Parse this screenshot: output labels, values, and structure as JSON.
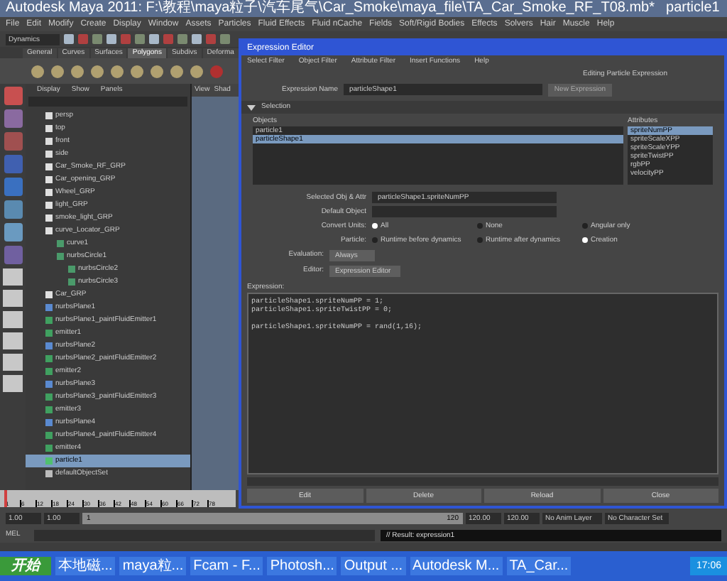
{
  "main_window": {
    "title": "Autodesk Maya 2011: F:\\教程\\maya粒子\\汽车尾气\\Car_Smoke\\maya_file\\TA_Car_Smoke_RF_T08.mb*",
    "subtitle": "particle1"
  },
  "menu_bar": [
    "File",
    "Edit",
    "Modify",
    "Create",
    "Display",
    "Window",
    "Assets",
    "Particles",
    "Fluid Effects",
    "Fluid nCache",
    "Fields",
    "Soft/Rigid Bodies",
    "Effects",
    "Solvers",
    "Hair",
    "Muscle",
    "Help"
  ],
  "mode_menu": "Dynamics",
  "shelf_tabs": [
    {
      "label": "General",
      "selected": false
    },
    {
      "label": "Curves",
      "selected": false
    },
    {
      "label": "Surfaces",
      "selected": false
    },
    {
      "label": "Polygons",
      "selected": true
    },
    {
      "label": "Subdivs",
      "selected": false
    },
    {
      "label": "Deforma",
      "selected": false
    }
  ],
  "outliner": {
    "menus": [
      "Display",
      "Show",
      "Panels"
    ],
    "items": [
      {
        "label": "persp",
        "kind": "camera",
        "selected": false
      },
      {
        "label": "top",
        "kind": "camera",
        "selected": false
      },
      {
        "label": "front",
        "kind": "camera",
        "selected": false
      },
      {
        "label": "side",
        "kind": "camera",
        "selected": false
      },
      {
        "label": "Car_Smoke_RF_GRP",
        "kind": "group",
        "selected": false
      },
      {
        "label": "Car_opening_GRP",
        "kind": "group",
        "selected": false
      },
      {
        "label": "Wheel_GRP",
        "kind": "group",
        "selected": false
      },
      {
        "label": "light_GRP",
        "kind": "group",
        "selected": false
      },
      {
        "label": "smoke_light_GRP",
        "kind": "group",
        "selected": false
      },
      {
        "label": "curve_Locator_GRP",
        "kind": "group",
        "selected": false,
        "children": [
          {
            "label": "curve1",
            "kind": "curve",
            "selected": false
          },
          {
            "label": "nurbsCircle1",
            "kind": "curve",
            "selected": false,
            "children": [
              {
                "label": "nurbsCircle2",
                "kind": "curve",
                "selected": false
              },
              {
                "label": "nurbsCircle3",
                "kind": "curve",
                "selected": false
              }
            ]
          }
        ]
      },
      {
        "label": "Car_GRP",
        "kind": "group",
        "selected": false
      },
      {
        "label": "nurbsPlane1",
        "kind": "plane",
        "selected": false
      },
      {
        "label": "nurbsPlane1_paintFluidEmitter1",
        "kind": "emitter",
        "selected": false
      },
      {
        "label": "emitter1",
        "kind": "emitter",
        "selected": false
      },
      {
        "label": "nurbsPlane2",
        "kind": "plane",
        "selected": false
      },
      {
        "label": "nurbsPlane2_paintFluidEmitter2",
        "kind": "emitter",
        "selected": false
      },
      {
        "label": "emitter2",
        "kind": "emitter",
        "selected": false
      },
      {
        "label": "nurbsPlane3",
        "kind": "plane",
        "selected": false
      },
      {
        "label": "nurbsPlane3_paintFluidEmitter3",
        "kind": "emitter",
        "selected": false
      },
      {
        "label": "emitter3",
        "kind": "emitter",
        "selected": false
      },
      {
        "label": "nurbsPlane4",
        "kind": "plane",
        "selected": false
      },
      {
        "label": "nurbsPlane4_paintFluidEmitter4",
        "kind": "emitter",
        "selected": false
      },
      {
        "label": "emitter4",
        "kind": "emitter",
        "selected": false
      },
      {
        "label": "particle1",
        "kind": "particle",
        "selected": true
      },
      {
        "label": "defaultObjectSet",
        "kind": "set",
        "selected": false
      }
    ]
  },
  "viewport_menus": [
    "View",
    "Shad"
  ],
  "expression_editor": {
    "title": "Expression Editor",
    "menus": [
      "Select Filter",
      "Object Filter",
      "Attribute Filter",
      "Insert Functions",
      "Help"
    ],
    "mode_label": "Editing Particle Expression",
    "name_label": "Expression Name",
    "name_value": "particleShape1",
    "new_button": "New Expression",
    "section": "Selection",
    "objects_label": "Objects",
    "objects": [
      {
        "label": "particle1",
        "selected": false
      },
      {
        "label": "particleShape1",
        "selected": true
      }
    ],
    "attributes_label": "Attributes",
    "attributes": [
      {
        "label": "spriteNumPP",
        "selected": true
      },
      {
        "label": "spriteScaleXPP",
        "selected": false
      },
      {
        "label": "spriteScaleYPP",
        "selected": false
      },
      {
        "label": "spriteTwistPP",
        "selected": false
      },
      {
        "label": "rgbPP",
        "selected": false
      },
      {
        "label": "velocityPP",
        "selected": false
      }
    ],
    "selected_label": "Selected Obj & Attr",
    "selected_value": "particleShape1.spriteNumPP",
    "default_label": "Default Object",
    "convert_label": "Convert Units:",
    "convert_options": [
      {
        "label": "All",
        "selected": true
      },
      {
        "label": "None",
        "selected": false
      },
      {
        "label": "Angular only",
        "selected": false
      }
    ],
    "particle_label": "Particle:",
    "particle_options": [
      {
        "label": "Runtime before dynamics",
        "selected": false
      },
      {
        "label": "Runtime after dynamics",
        "selected": false
      },
      {
        "label": "Creation",
        "selected": true
      }
    ],
    "evaluation_label": "Evaluation:",
    "evaluation_value": "Always",
    "editor_label": "Editor:",
    "editor_value": "Expression Editor",
    "expression_label": "Expression:",
    "expression_blocks": [
      [
        "particleShape1.spriteNumPP = 1;",
        "particleShape1.spriteTwistPP = 0;"
      ],
      [
        "particleShape1.spriteNumPP = rand(1,16);"
      ]
    ],
    "buttons": [
      "Edit",
      "Delete",
      "Reload",
      "Close"
    ]
  },
  "time_slider": {
    "ticks": [
      "1",
      "6",
      "12",
      "18",
      "24",
      "30",
      "36",
      "42",
      "48",
      "54",
      "60",
      "66",
      "72",
      "78"
    ],
    "level": 0
  },
  "range_bar": {
    "start": "1.00",
    "inner_start": "1.00",
    "slider_start": "1",
    "slider_end": "120",
    "level": 1,
    "inner_end": "120.00",
    "end": "120.00",
    "anim_layer": "No Anim Layer",
    "character_set": "No Character Set"
  },
  "command_line": {
    "label": "MEL",
    "result": "// Result: expression1"
  },
  "taskbar": {
    "start": "开始",
    "items": [
      "本地磁...",
      "maya粒...",
      "Fcam - F...",
      "Photosh...",
      "Output ...",
      "Autodesk M...",
      "TA_Car..."
    ],
    "clock": "17:06"
  }
}
